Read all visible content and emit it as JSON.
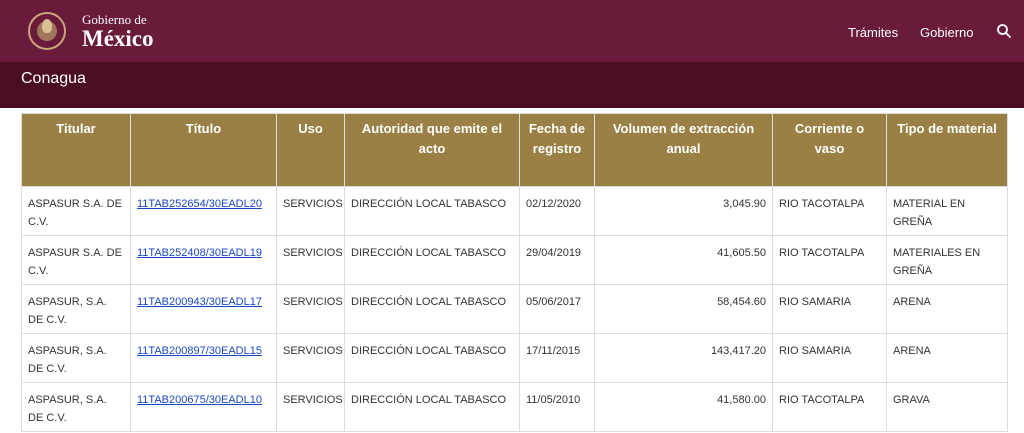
{
  "header": {
    "logo_line1": "Gobierno de",
    "logo_line2": "México",
    "nav": [
      "Trámites",
      "Gobierno"
    ],
    "search_icon": "search-icon"
  },
  "subheader": {
    "title": "Conagua"
  },
  "table": {
    "columns": [
      "Titular",
      "Título",
      "Uso",
      "Autoridad que emite el acto",
      "Fecha de registro",
      "Volumen de extracción anual",
      "Corriente o vaso",
      "Tipo de material"
    ],
    "rows": [
      [
        "ASPASUR S.A. DE C.V.",
        "11TAB252654/30EADL20",
        "SERVICIOS",
        "DIRECCIÓN LOCAL TABASCO",
        "02/12/2020",
        "3,045.90",
        "RIO TACOTALPA",
        "MATERIAL EN GREÑA"
      ],
      [
        "ASPASUR S.A. DE C.V.",
        "11TAB252408/30EADL19",
        "SERVICIOS",
        "DIRECCIÓN LOCAL TABASCO",
        "29/04/2019",
        "41,605.50",
        "RIO TACOTALPA",
        "MATERIALES EN GREÑA"
      ],
      [
        "ASPASUR, S.A. DE C.V.",
        "11TAB200943/30EADL17",
        "SERVICIOS",
        "DIRECCIÓN LOCAL TABASCO",
        "05/06/2017",
        "58,454.60",
        "RIO SAMARIA",
        "ARENA"
      ],
      [
        "ASPASUR, S.A. DE C.V.",
        "11TAB200897/30EADL15",
        "SERVICIOS",
        "DIRECCIÓN LOCAL TABASCO",
        "17/11/2015",
        "143,417.20",
        "RIO SAMARIA",
        "ARENA"
      ],
      [
        "ASPASUR, S.A. DE C.V.",
        "11TAB200675/30EADL10",
        "SERVICIOS",
        "DIRECCIÓN LOCAL TABASCO",
        "11/05/2010",
        "41,580.00",
        "RIO TACOTALPA",
        "GRAVA"
      ]
    ]
  },
  "colors": {
    "header_bg": "#6a1a3a",
    "subheader_bg": "#4b0e20",
    "table_header_bg": "#9a8044",
    "link": "#1a47c4"
  }
}
